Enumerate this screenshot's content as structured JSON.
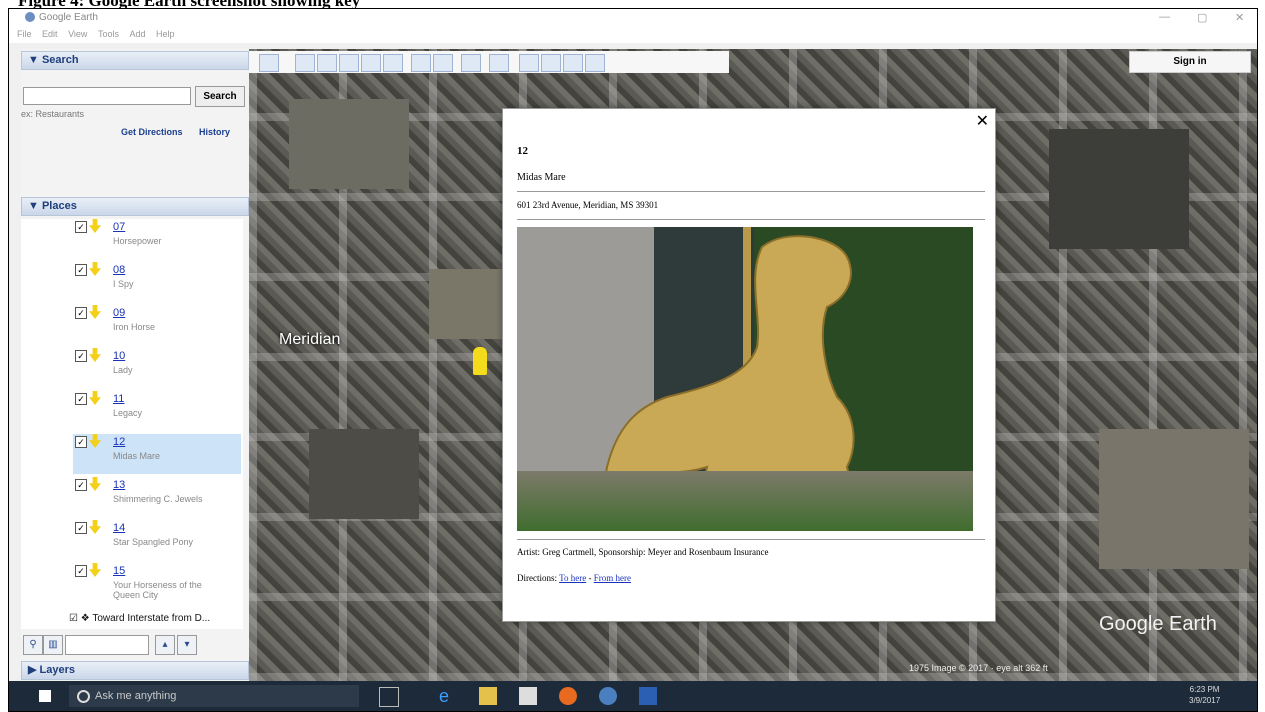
{
  "caption": "Figure 4: Google Earth screenshot showing key",
  "app": {
    "title": "Google Earth"
  },
  "menu": [
    "File",
    "Edit",
    "View",
    "Tools",
    "Add",
    "Help"
  ],
  "search": {
    "header": "▼ Search",
    "button": "Search",
    "hint": "ex: Restaurants",
    "get_directions": "Get Directions",
    "history": "History"
  },
  "places": {
    "header": "▼ Places",
    "items": [
      {
        "num": "07",
        "name": "Horsepower"
      },
      {
        "num": "08",
        "name": "I Spy"
      },
      {
        "num": "09",
        "name": "Iron Horse"
      },
      {
        "num": "10",
        "name": "Lady"
      },
      {
        "num": "11",
        "name": "Legacy"
      },
      {
        "num": "12",
        "name": "Midas Mare",
        "selected": true
      },
      {
        "num": "13",
        "name": "Shimmering C. Jewels"
      },
      {
        "num": "14",
        "name": "Star Spangled Pony"
      },
      {
        "num": "15",
        "name": "Your Horseness of the Queen City"
      }
    ],
    "bottom_item": "Toward Interstate from D..."
  },
  "layers_header": "▶ Layers",
  "toolbar": {
    "sign_in": "Sign in"
  },
  "map": {
    "city_label": "Meridian",
    "logo": "Google Earth",
    "status": "1975   Image © 2017 · eye alt 362 ft"
  },
  "popup": {
    "title": "12",
    "name": "Midas Mare",
    "address": "601 23rd Avenue, Meridian, MS 39301",
    "artist": "Artist: Greg Cartmell, Sponsorship: Meyer and Rosenbaum Insurance",
    "directions_label": "Directions:",
    "to_here": "To here",
    "sep": "-",
    "from_here": "From here"
  },
  "taskbar": {
    "search_placeholder": "Ask me anything",
    "time": "6:23 PM",
    "date": "3/9/2017"
  },
  "colors": {
    "accent": "#1b3f8f",
    "selected": "#cde3f7",
    "taskbar": "#1c2a3a"
  }
}
